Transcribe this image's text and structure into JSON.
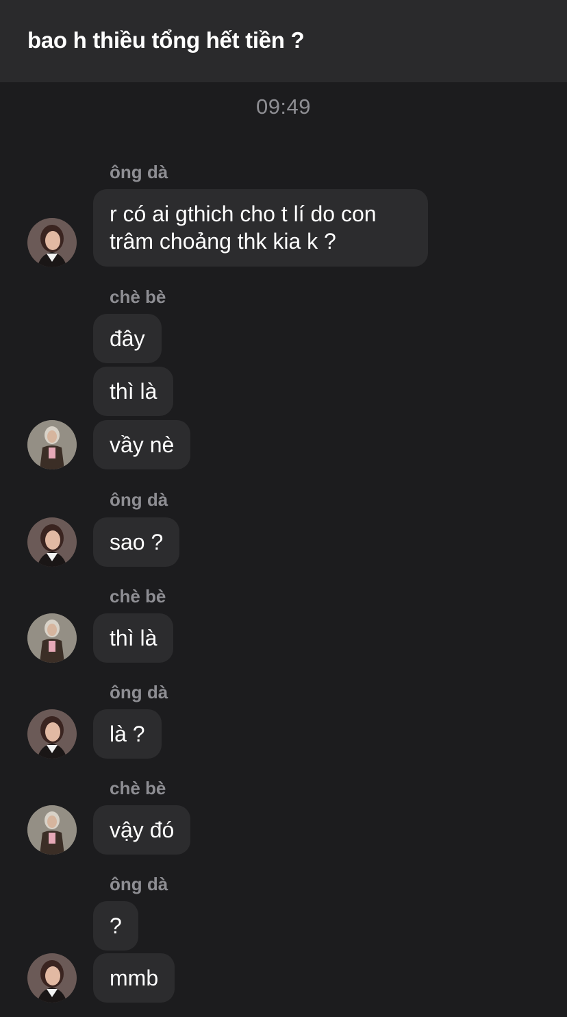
{
  "header": {
    "title": "bao h thiều tổng hết tiền ?"
  },
  "timestamp": "09:49",
  "senders": {
    "a": "ông dà",
    "b": "chè bè"
  },
  "messages": [
    "r có ai gthich cho t lí do con trâm choảng thk kia k ?",
    "đây",
    "thì là",
    "vầy nè",
    "sao ?",
    "thì là",
    "là ?",
    "vậy đó",
    "?",
    "mmb"
  ]
}
